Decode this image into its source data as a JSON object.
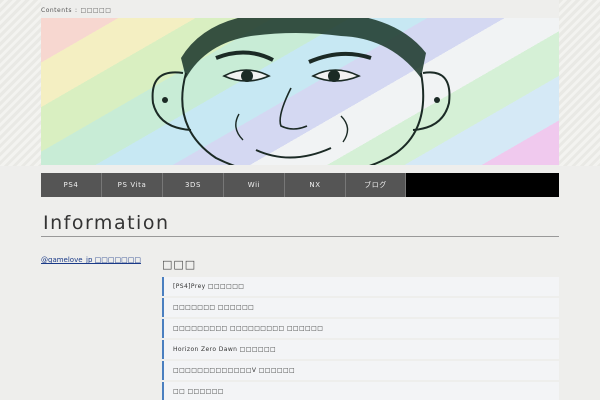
{
  "topbar": {
    "contents_label": "Contents",
    "separator": ":",
    "suffix": "□□□□□"
  },
  "banner": {
    "illustration": "rainbow-face-illustration"
  },
  "nav": {
    "items": [
      {
        "label": "PS4"
      },
      {
        "label": "PS Vita"
      },
      {
        "label": "3DS"
      },
      {
        "label": "Wii"
      },
      {
        "label": "NX"
      },
      {
        "label": "ブログ"
      }
    ]
  },
  "page": {
    "title": "Information"
  },
  "sidebar": {
    "twitter_link": "@gamelove_jp □□□□□□□"
  },
  "main": {
    "section_title": "□□□",
    "items": [
      {
        "label": "[PS4]Prey □□□□□□"
      },
      {
        "label": "□□□□□□□ □□□□□□"
      },
      {
        "label": "□□□□□□□□□ □□□□□□□□□ □□□□□□"
      },
      {
        "label": "Horizon Zero Dawn □□□□□□"
      },
      {
        "label": "□□□□□□□□□□□□□V □□□□□□"
      },
      {
        "label": "□□ □□□□□□"
      }
    ]
  },
  "colors": {
    "nav_bg": "#555555",
    "accent": "#4a7fc0",
    "list_bg": "#f3f4f6"
  }
}
